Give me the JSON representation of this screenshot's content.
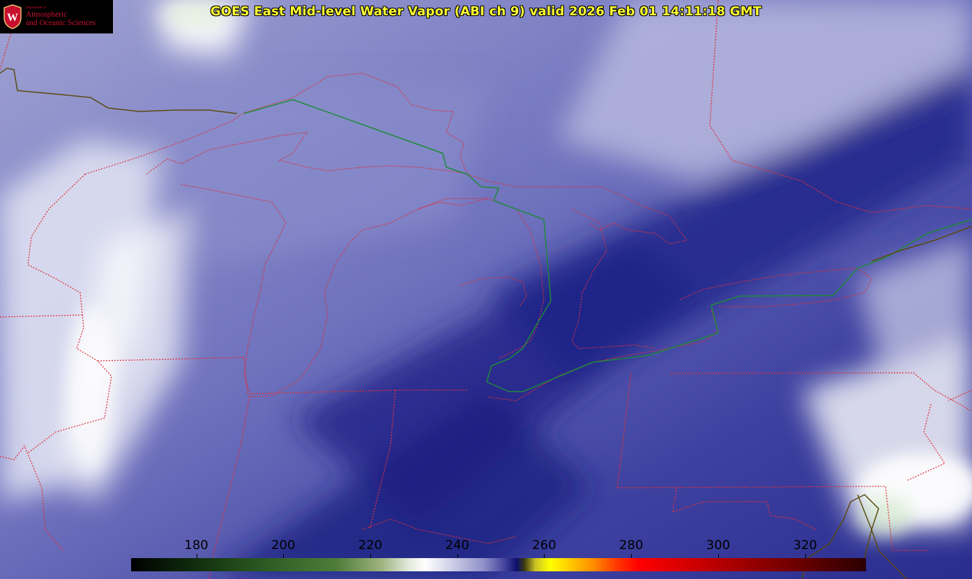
{
  "title": "GOES East Mid-level Water Vapor (ABI ch 9)  valid 2026 Feb 01 14:11:18 GMT",
  "logo": {
    "line1": "Department of",
    "line2": "Atmospheric",
    "line3": "and Oceanic Sciences",
    "emblem_letter": "W"
  },
  "colorbar": {
    "min": 165,
    "max": 334,
    "ticks": [
      {
        "value": 180,
        "label": "180"
      },
      {
        "value": 200,
        "label": "200"
      },
      {
        "value": 220,
        "label": "220"
      },
      {
        "value": 240,
        "label": "240"
      },
      {
        "value": 260,
        "label": "260"
      },
      {
        "value": 280,
        "label": "280"
      },
      {
        "value": 300,
        "label": "300"
      },
      {
        "value": 320,
        "label": "320"
      }
    ]
  },
  "colors": {
    "title": "#ffff33",
    "state_borders": "#e0303a",
    "international_border": "#1e8a3a",
    "coastline": "#5a4a10",
    "logo_red": "#c8102e"
  }
}
